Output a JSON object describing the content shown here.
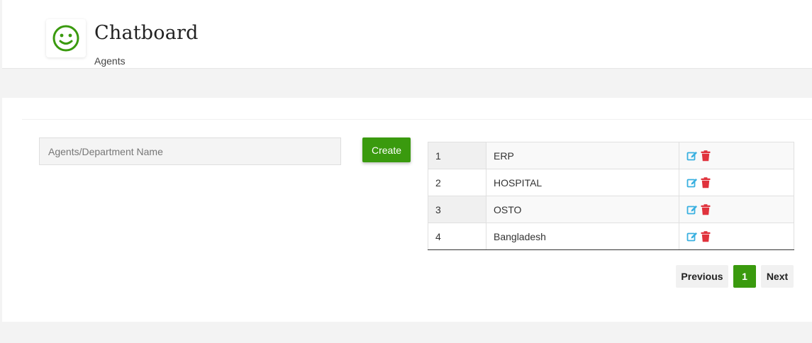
{
  "header": {
    "title": "Chatboard",
    "subtitle": "Agents"
  },
  "form": {
    "name_placeholder": "Agents/Department Name",
    "create_label": "Create"
  },
  "table": {
    "rows": [
      {
        "id": "1",
        "name": "ERP"
      },
      {
        "id": "2",
        "name": "HOSPITAL"
      },
      {
        "id": "3",
        "name": "OSTO"
      },
      {
        "id": "4",
        "name": "Bangladesh"
      }
    ]
  },
  "pagination": {
    "previous_label": "Previous",
    "current_page": "1",
    "next_label": "Next"
  },
  "colors": {
    "accent": "#3a9a0e",
    "edit_icon": "#3ab0e0",
    "delete_icon": "#e0323c"
  }
}
